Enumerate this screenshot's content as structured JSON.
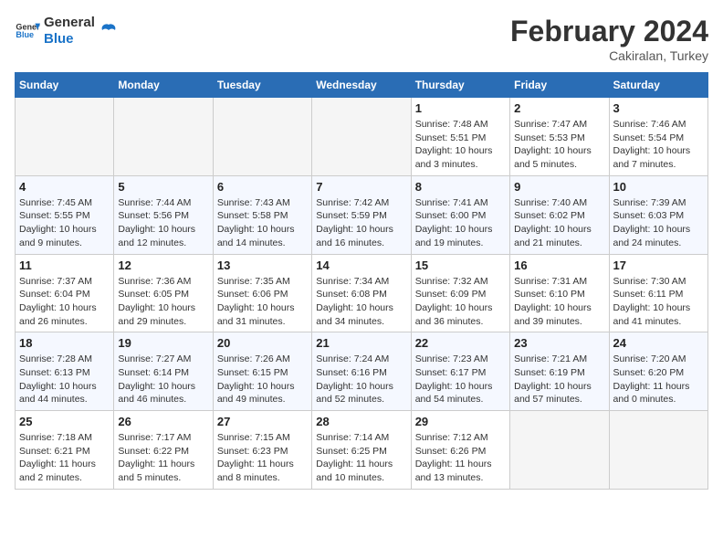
{
  "header": {
    "logo_line1": "General",
    "logo_line2": "Blue",
    "month_year": "February 2024",
    "location": "Cakiralan, Turkey"
  },
  "weekdays": [
    "Sunday",
    "Monday",
    "Tuesday",
    "Wednesday",
    "Thursday",
    "Friday",
    "Saturday"
  ],
  "weeks": [
    {
      "days": [
        {
          "num": "",
          "info": ""
        },
        {
          "num": "",
          "info": ""
        },
        {
          "num": "",
          "info": ""
        },
        {
          "num": "",
          "info": ""
        },
        {
          "num": "1",
          "sunrise": "7:48 AM",
          "sunset": "5:51 PM",
          "daylight": "10 hours and 3 minutes."
        },
        {
          "num": "2",
          "sunrise": "7:47 AM",
          "sunset": "5:53 PM",
          "daylight": "10 hours and 5 minutes."
        },
        {
          "num": "3",
          "sunrise": "7:46 AM",
          "sunset": "5:54 PM",
          "daylight": "10 hours and 7 minutes."
        }
      ]
    },
    {
      "days": [
        {
          "num": "4",
          "sunrise": "7:45 AM",
          "sunset": "5:55 PM",
          "daylight": "10 hours and 9 minutes."
        },
        {
          "num": "5",
          "sunrise": "7:44 AM",
          "sunset": "5:56 PM",
          "daylight": "10 hours and 12 minutes."
        },
        {
          "num": "6",
          "sunrise": "7:43 AM",
          "sunset": "5:58 PM",
          "daylight": "10 hours and 14 minutes."
        },
        {
          "num": "7",
          "sunrise": "7:42 AM",
          "sunset": "5:59 PM",
          "daylight": "10 hours and 16 minutes."
        },
        {
          "num": "8",
          "sunrise": "7:41 AM",
          "sunset": "6:00 PM",
          "daylight": "10 hours and 19 minutes."
        },
        {
          "num": "9",
          "sunrise": "7:40 AM",
          "sunset": "6:02 PM",
          "daylight": "10 hours and 21 minutes."
        },
        {
          "num": "10",
          "sunrise": "7:39 AM",
          "sunset": "6:03 PM",
          "daylight": "10 hours and 24 minutes."
        }
      ]
    },
    {
      "days": [
        {
          "num": "11",
          "sunrise": "7:37 AM",
          "sunset": "6:04 PM",
          "daylight": "10 hours and 26 minutes."
        },
        {
          "num": "12",
          "sunrise": "7:36 AM",
          "sunset": "6:05 PM",
          "daylight": "10 hours and 29 minutes."
        },
        {
          "num": "13",
          "sunrise": "7:35 AM",
          "sunset": "6:06 PM",
          "daylight": "10 hours and 31 minutes."
        },
        {
          "num": "14",
          "sunrise": "7:34 AM",
          "sunset": "6:08 PM",
          "daylight": "10 hours and 34 minutes."
        },
        {
          "num": "15",
          "sunrise": "7:32 AM",
          "sunset": "6:09 PM",
          "daylight": "10 hours and 36 minutes."
        },
        {
          "num": "16",
          "sunrise": "7:31 AM",
          "sunset": "6:10 PM",
          "daylight": "10 hours and 39 minutes."
        },
        {
          "num": "17",
          "sunrise": "7:30 AM",
          "sunset": "6:11 PM",
          "daylight": "10 hours and 41 minutes."
        }
      ]
    },
    {
      "days": [
        {
          "num": "18",
          "sunrise": "7:28 AM",
          "sunset": "6:13 PM",
          "daylight": "10 hours and 44 minutes."
        },
        {
          "num": "19",
          "sunrise": "7:27 AM",
          "sunset": "6:14 PM",
          "daylight": "10 hours and 46 minutes."
        },
        {
          "num": "20",
          "sunrise": "7:26 AM",
          "sunset": "6:15 PM",
          "daylight": "10 hours and 49 minutes."
        },
        {
          "num": "21",
          "sunrise": "7:24 AM",
          "sunset": "6:16 PM",
          "daylight": "10 hours and 52 minutes."
        },
        {
          "num": "22",
          "sunrise": "7:23 AM",
          "sunset": "6:17 PM",
          "daylight": "10 hours and 54 minutes."
        },
        {
          "num": "23",
          "sunrise": "7:21 AM",
          "sunset": "6:19 PM",
          "daylight": "10 hours and 57 minutes."
        },
        {
          "num": "24",
          "sunrise": "7:20 AM",
          "sunset": "6:20 PM",
          "daylight": "11 hours and 0 minutes."
        }
      ]
    },
    {
      "days": [
        {
          "num": "25",
          "sunrise": "7:18 AM",
          "sunset": "6:21 PM",
          "daylight": "11 hours and 2 minutes."
        },
        {
          "num": "26",
          "sunrise": "7:17 AM",
          "sunset": "6:22 PM",
          "daylight": "11 hours and 5 minutes."
        },
        {
          "num": "27",
          "sunrise": "7:15 AM",
          "sunset": "6:23 PM",
          "daylight": "11 hours and 8 minutes."
        },
        {
          "num": "28",
          "sunrise": "7:14 AM",
          "sunset": "6:25 PM",
          "daylight": "11 hours and 10 minutes."
        },
        {
          "num": "29",
          "sunrise": "7:12 AM",
          "sunset": "6:26 PM",
          "daylight": "11 hours and 13 minutes."
        },
        {
          "num": "",
          "info": ""
        },
        {
          "num": "",
          "info": ""
        }
      ]
    }
  ]
}
